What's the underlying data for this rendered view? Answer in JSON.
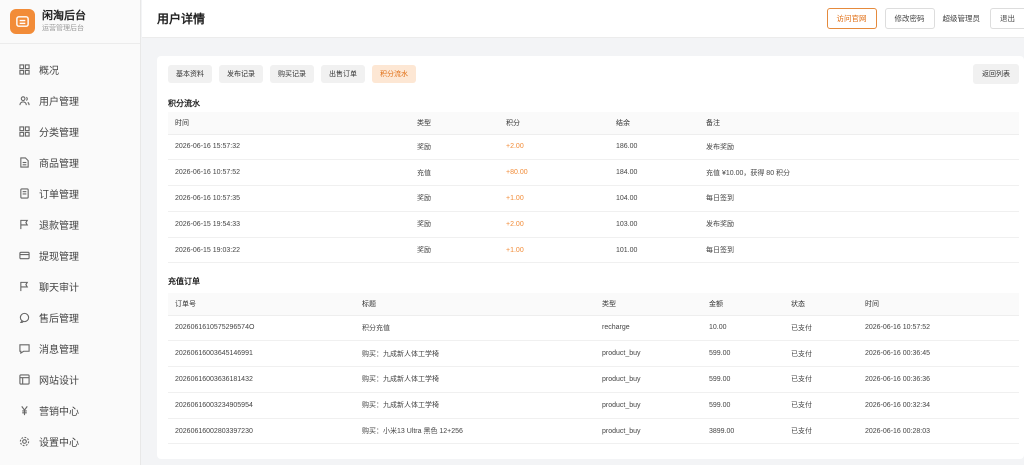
{
  "brand": {
    "title": "闲淘后台",
    "subtitle": "运营管理后台"
  },
  "sidebar": {
    "items": [
      {
        "label": "概况",
        "icon": "grid-icon"
      },
      {
        "label": "用户管理",
        "icon": "users-icon"
      },
      {
        "label": "分类管理",
        "icon": "category-icon"
      },
      {
        "label": "商品管理",
        "icon": "document-icon"
      },
      {
        "label": "订单管理",
        "icon": "order-icon"
      },
      {
        "label": "退款管理",
        "icon": "flag-icon"
      },
      {
        "label": "提现管理",
        "icon": "card-icon"
      },
      {
        "label": "聊天审计",
        "icon": "flag-icon"
      },
      {
        "label": "售后管理",
        "icon": "chat-bubble-icon"
      },
      {
        "label": "消息管理",
        "icon": "message-icon"
      },
      {
        "label": "网站设计",
        "icon": "layout-icon"
      },
      {
        "label": "营销中心",
        "icon": "yen-icon"
      },
      {
        "label": "设置中心",
        "icon": "gear-icon"
      }
    ]
  },
  "header": {
    "title": "用户详情",
    "visit_label": "访问官网",
    "password_label": "修改密码",
    "admin_name": "超级管理员",
    "logout_label": "退出"
  },
  "tabs": [
    {
      "label": "基本资料",
      "active": false
    },
    {
      "label": "发布记录",
      "active": false
    },
    {
      "label": "购买记录",
      "active": false
    },
    {
      "label": "出售订单",
      "active": false
    },
    {
      "label": "积分流水",
      "active": true
    }
  ],
  "back_label": "返回列表",
  "points": {
    "title": "积分流水",
    "columns": [
      "时间",
      "类型",
      "积分",
      "结余",
      "备注"
    ],
    "rows": [
      [
        "2026-06-16 15:57:32",
        "奖励",
        "+2.00",
        "186.00",
        "发布奖励"
      ],
      [
        "2026-06-16 10:57:52",
        "充值",
        "+80.00",
        "184.00",
        "充值 ¥10.00，获得 80 积分"
      ],
      [
        "2026-06-16 10:57:35",
        "奖励",
        "+1.00",
        "104.00",
        "每日签到"
      ],
      [
        "2026-06-15 19:54:33",
        "奖励",
        "+2.00",
        "103.00",
        "发布奖励"
      ],
      [
        "2026-06-15 19:03:22",
        "奖励",
        "+1.00",
        "101.00",
        "每日签到"
      ]
    ]
  },
  "recharge": {
    "title": "充值订单",
    "columns": [
      "订单号",
      "标题",
      "类型",
      "金额",
      "状态",
      "时间"
    ],
    "rows": [
      [
        "2026061610575296574O",
        "积分充值",
        "recharge",
        "10.00",
        "已支付",
        "2026-06-16 10:57:52"
      ],
      [
        "20260616003645146991",
        "购买：九成新人体工学椅",
        "product_buy",
        "599.00",
        "已支付",
        "2026-06-16 00:36:45"
      ],
      [
        "20260616003636181432",
        "购买：九成新人体工学椅",
        "product_buy",
        "599.00",
        "已支付",
        "2026-06-16 00:36:36"
      ],
      [
        "20260616003234905954",
        "购买：九成新人体工学椅",
        "product_buy",
        "599.00",
        "已支付",
        "2026-06-16 00:32:34"
      ],
      [
        "20260616002803397230",
        "购买：小米13 Ultra 黑色 12+256",
        "product_buy",
        "3899.00",
        "已支付",
        "2026-06-16 00:28:03"
      ]
    ]
  }
}
